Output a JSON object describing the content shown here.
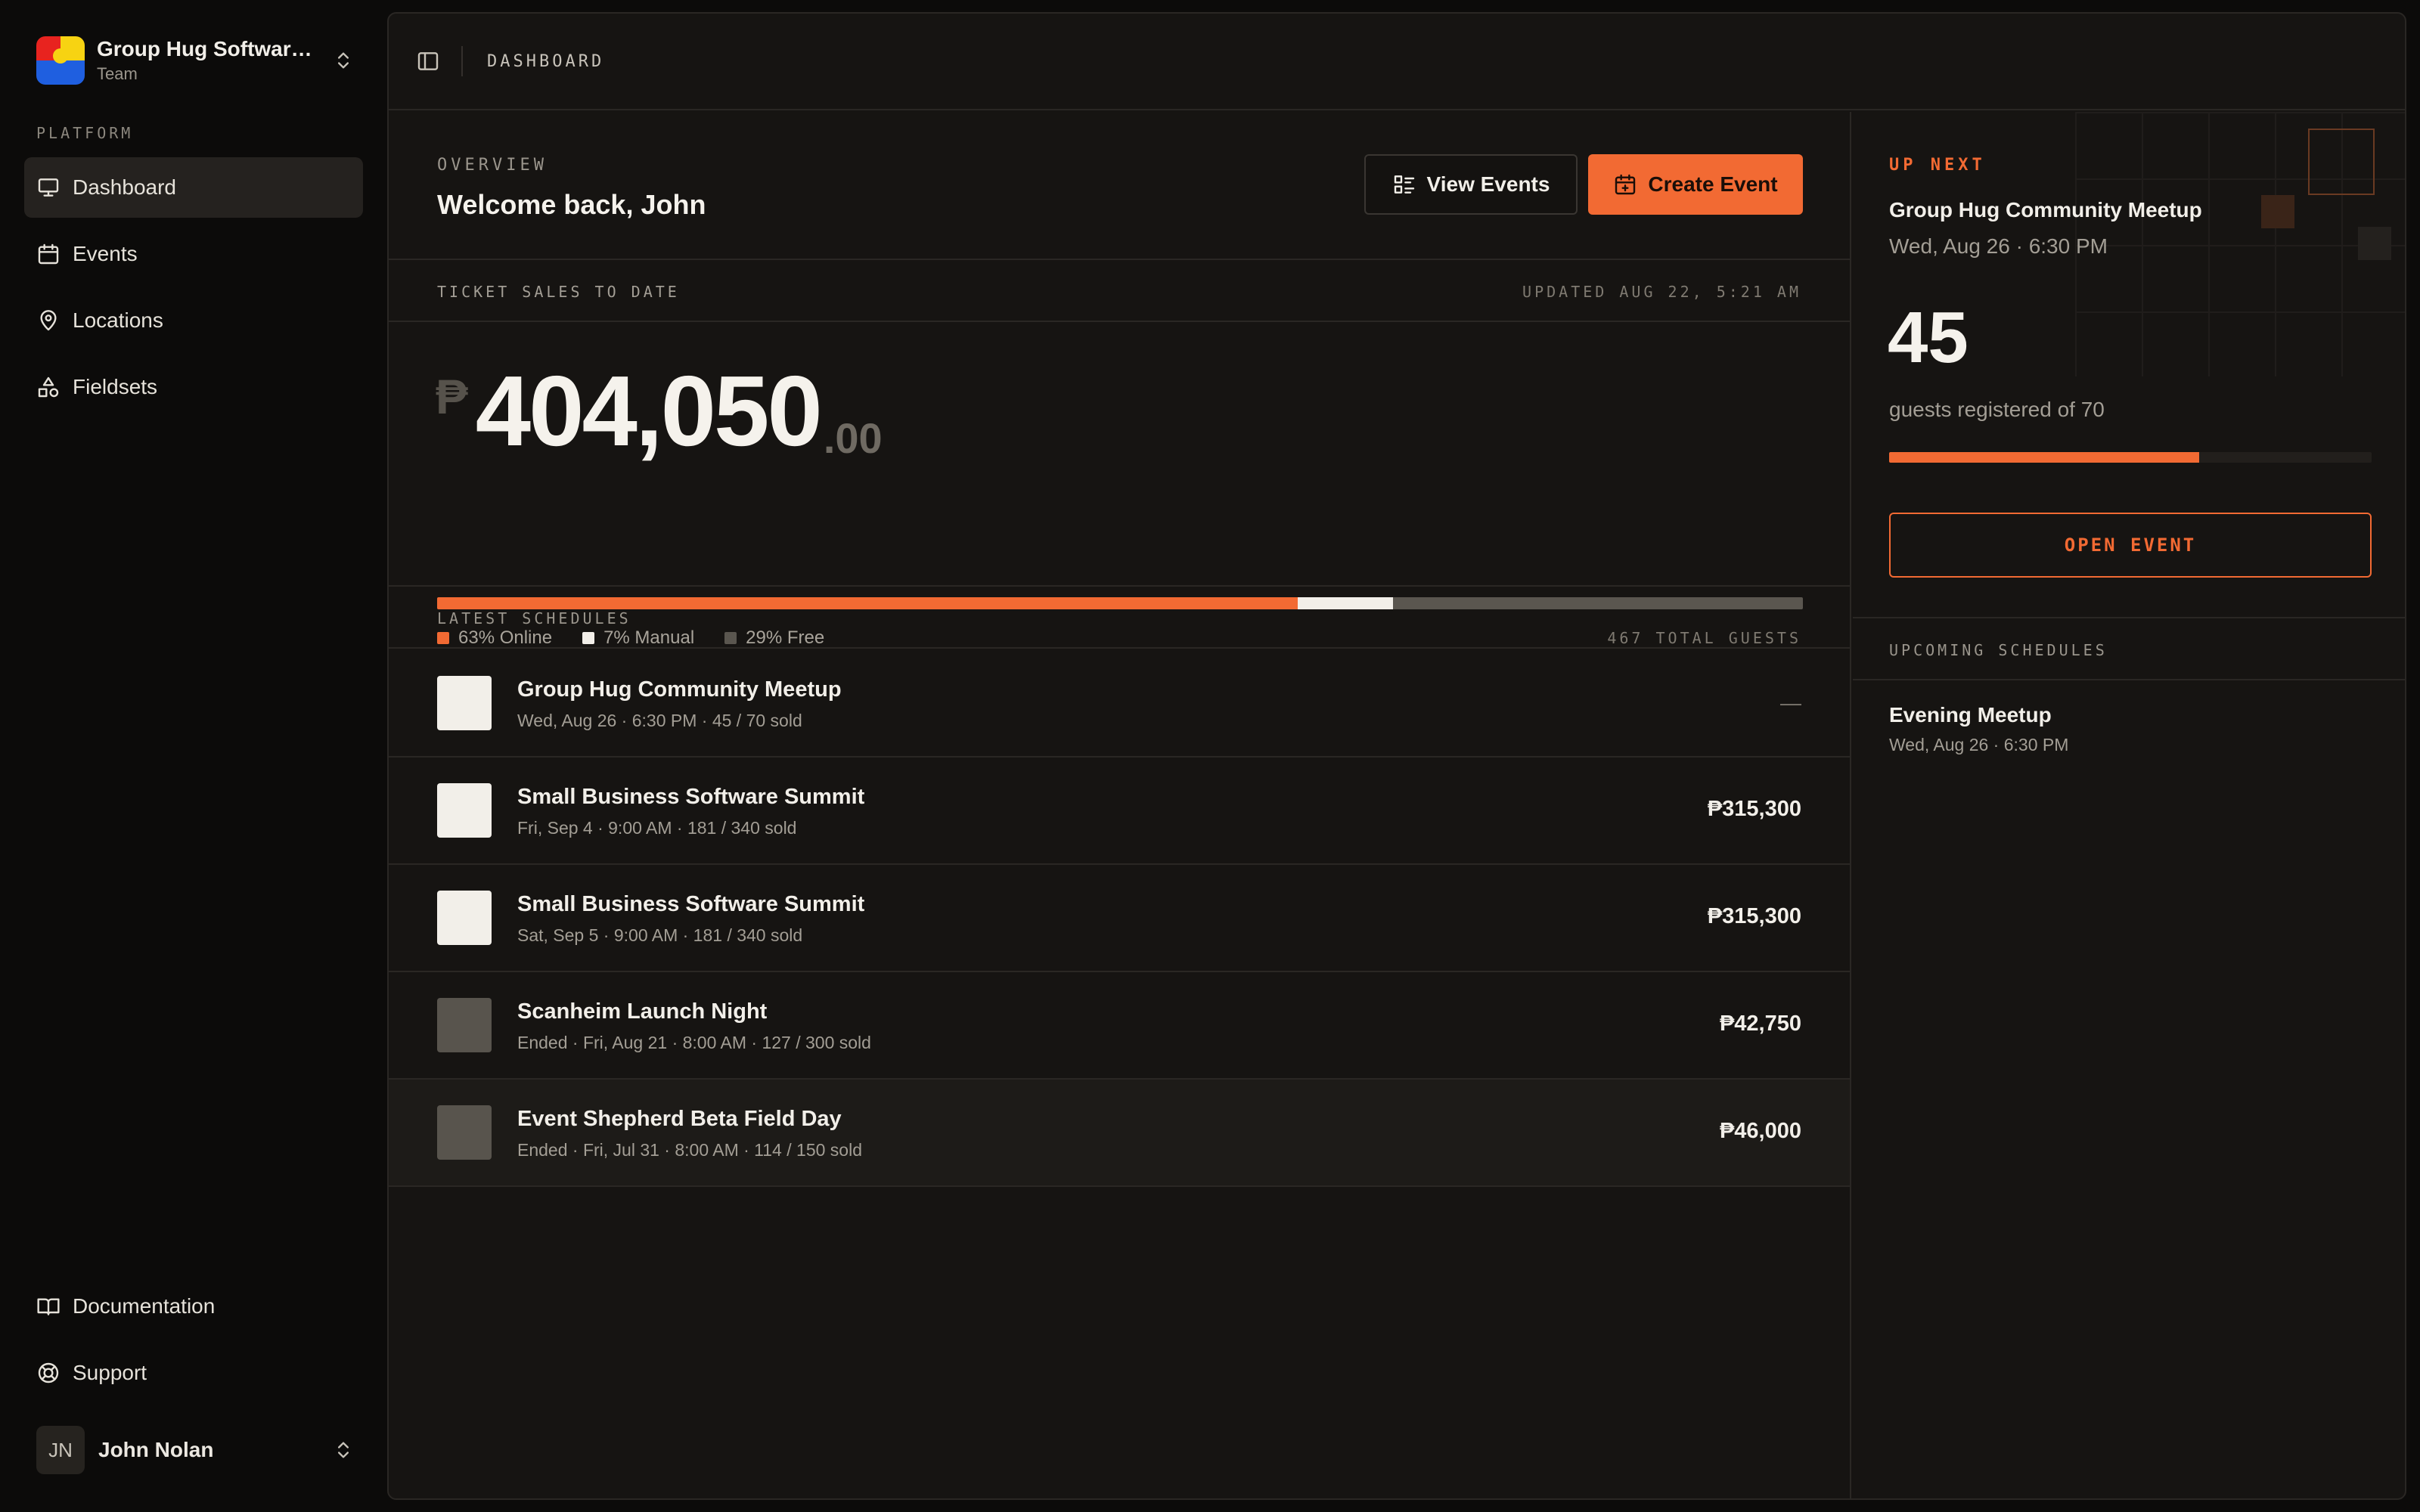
{
  "colors": {
    "accent": "#f26a33",
    "manual": "#f2efe9",
    "free": "#5a564f",
    "thumb_light": "#f2efe9",
    "thumb_dark": "#58544d"
  },
  "sidebar": {
    "team_name": "Group Hug Software...",
    "team_sub": "Team",
    "section_label": "PLATFORM",
    "items": [
      {
        "label": "Dashboard",
        "icon": "monitor-icon"
      },
      {
        "label": "Events",
        "icon": "calendar-icon"
      },
      {
        "label": "Locations",
        "icon": "map-pin-icon"
      },
      {
        "label": "Fieldsets",
        "icon": "shapes-icon"
      }
    ],
    "footer_items": [
      {
        "label": "Documentation",
        "icon": "book-icon"
      },
      {
        "label": "Support",
        "icon": "lifebuoy-icon"
      }
    ],
    "user": {
      "initials": "JN",
      "name": "John Nolan"
    }
  },
  "topbar": {
    "breadcrumb": "DASHBOARD"
  },
  "overview": {
    "eyebrow": "OVERVIEW",
    "welcome": "Welcome back, John",
    "view_events": "View Events",
    "create_event": "Create Event"
  },
  "sales": {
    "label": "TICKET SALES TO DATE",
    "updated": "UPDATED AUG 22, 5:21 AM",
    "currency": "₱",
    "amount": "404,050",
    "decimals": ".00",
    "breakdown": [
      {
        "label": "63% Online",
        "percent": 63,
        "color": "#f26a33"
      },
      {
        "label": "7% Manual",
        "percent": 7,
        "color": "#f2efe9"
      },
      {
        "label": "29% Free",
        "percent": 30,
        "color": "#5a564f"
      }
    ],
    "total_guests": "467 TOTAL GUESTS"
  },
  "schedules": {
    "label": "LATEST SCHEDULES",
    "rows": [
      {
        "title": "Group Hug Community Meetup",
        "meta": "Wed, Aug 26 · 6:30 PM · 45 / 70 sold",
        "value": "—",
        "thumb": "light"
      },
      {
        "title": "Small Business Software Summit",
        "meta": "Fri, Sep 4 · 9:00 AM · 181 / 340 sold",
        "value": "₱315,300",
        "thumb": "light"
      },
      {
        "title": "Small Business Software Summit",
        "meta": "Sat, Sep 5 · 9:00 AM · 181 / 340 sold",
        "value": "₱315,300",
        "thumb": "light"
      },
      {
        "title": "Scanheim Launch Night",
        "meta": "Ended · Fri, Aug 21 · 8:00 AM · 127 / 300 sold",
        "value": "₱42,750",
        "thumb": "dark"
      },
      {
        "title": "Event Shepherd Beta Field Day",
        "meta": "Ended · Fri, Jul 31 · 8:00 AM · 114 / 150 sold",
        "value": "₱46,000",
        "thumb": "dark"
      }
    ]
  },
  "up_next": {
    "label": "UP NEXT",
    "title": "Group Hug Community Meetup",
    "date": "Wed, Aug 26 · 6:30 PM",
    "count": "45",
    "count_sub": "guests registered of 70",
    "progress": 0.643,
    "button": "OPEN EVENT"
  },
  "upcoming": {
    "label": "UPCOMING SCHEDULES",
    "items": [
      {
        "title": "Evening Meetup",
        "meta": "Wed, Aug 26 · 6:30 PM"
      }
    ]
  }
}
